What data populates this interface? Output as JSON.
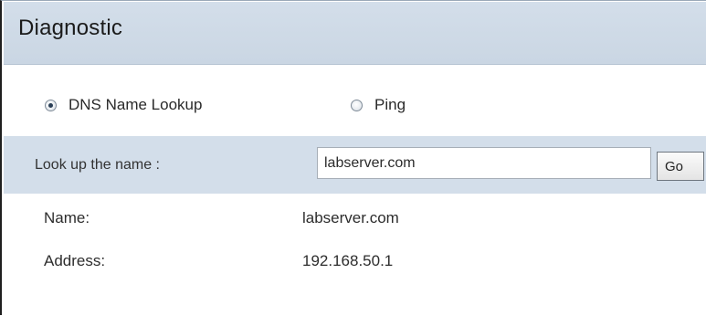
{
  "page": {
    "title": "Diagnostic"
  },
  "mode": {
    "options": [
      {
        "label": "DNS Name Lookup",
        "checked": true
      },
      {
        "label": "Ping",
        "checked": false
      }
    ]
  },
  "lookup": {
    "label": "Look up the name :",
    "value": "labserver.com",
    "button_label": "Go"
  },
  "results": {
    "name_label": "Name:",
    "name_value": "labserver.com",
    "address_label": "Address:",
    "address_value": "192.168.50.1"
  },
  "colors": {
    "header_background": "#d3deea",
    "lookup_row_background": "#d3deea",
    "text": "#2d2d2d"
  }
}
